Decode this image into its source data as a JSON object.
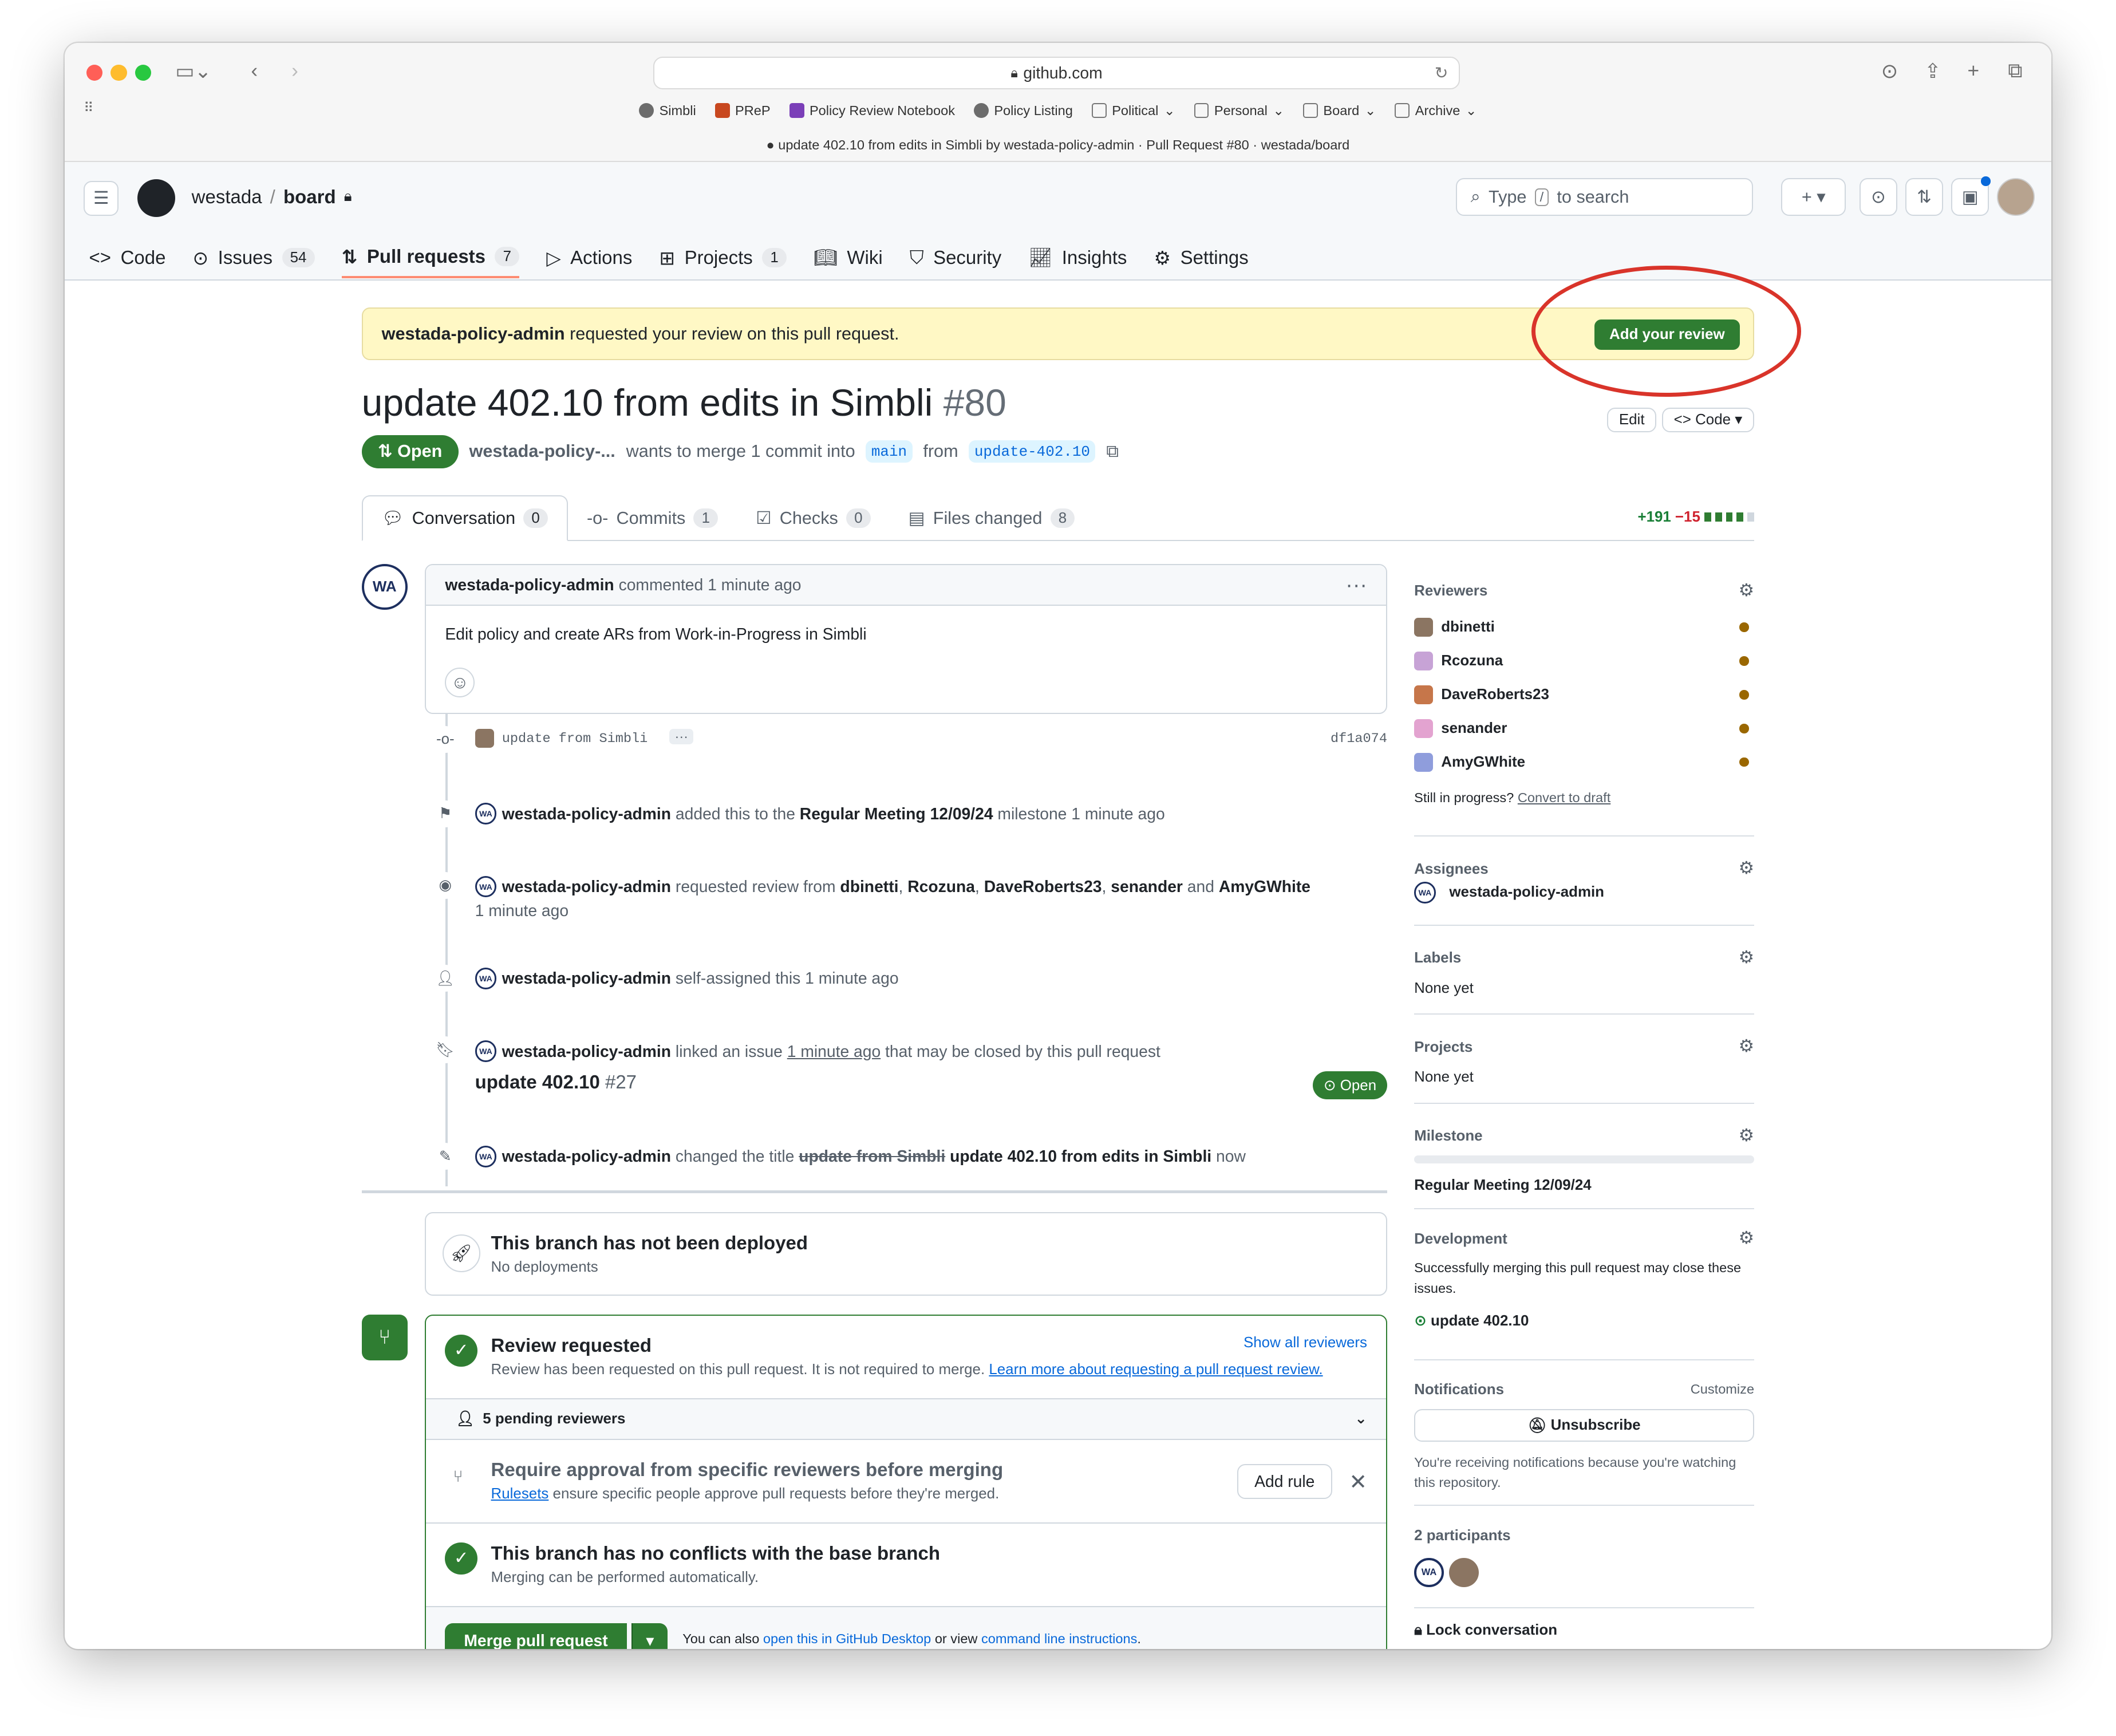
{
  "browser": {
    "url": "github.com",
    "bookmarks": [
      "Simbli",
      "PReP",
      "Policy Review Notebook",
      "Policy Listing",
      "Political",
      "Personal",
      "Board",
      "Archive"
    ],
    "tab_title": "update 402.10 from edits in Simbli by westada-policy-admin · Pull Request #80 · westada/board"
  },
  "repo": {
    "owner": "westada",
    "name": "board"
  },
  "search": {
    "placeholder_pre": "Type",
    "key": "/",
    "placeholder_post": "to search"
  },
  "nav": [
    {
      "label": "Code"
    },
    {
      "label": "Issues",
      "count": "54"
    },
    {
      "label": "Pull requests",
      "count": "7"
    },
    {
      "label": "Actions"
    },
    {
      "label": "Projects",
      "count": "1"
    },
    {
      "label": "Wiki"
    },
    {
      "label": "Security"
    },
    {
      "label": "Insights"
    },
    {
      "label": "Settings"
    }
  ],
  "banner": {
    "user": "westada-policy-admin",
    "text": "requested your review on this pull request.",
    "button": "Add your review"
  },
  "pr": {
    "title": "update 402.10 from edits in Simbli",
    "number": "#80",
    "edit": "Edit",
    "code": "Code",
    "status": "Open",
    "author": "westada-policy-...",
    "merge_text": "wants to merge 1 commit into",
    "base": "main",
    "from": "from",
    "head": "update-402.10"
  },
  "tabs": [
    {
      "label": "Conversation",
      "count": "0"
    },
    {
      "label": "Commits",
      "count": "1"
    },
    {
      "label": "Checks",
      "count": "0"
    },
    {
      "label": "Files changed",
      "count": "8"
    }
  ],
  "diffstat": {
    "add": "+191",
    "del": "−15"
  },
  "comment": {
    "author": "westada-policy-admin",
    "action": "commented 1 minute ago",
    "body": "Edit policy and create ARs from Work-in-Progress in Simbli"
  },
  "commit": {
    "message": "update from Simbli",
    "sha": "df1a074"
  },
  "events": {
    "milestone": {
      "user": "westada-policy-admin",
      "pre": "added this to the",
      "milestone": "Regular Meeting 12/09/24",
      "post": "milestone 1 minute ago"
    },
    "review": {
      "user": "westada-policy-admin",
      "pre": "requested review from",
      "r1": "dbinetti",
      "r2": "Rcozuna",
      "r3": "DaveRoberts23",
      "r4": "senander",
      "and": "and",
      "r5": "AmyGWhite",
      "time": "1 minute ago"
    },
    "assign": {
      "user": "westada-policy-admin",
      "text": "self-assigned this 1 minute ago"
    },
    "link": {
      "user": "westada-policy-admin",
      "pre": "linked an issue",
      "time": "1 minute ago",
      "post": "that may be closed by this pull request",
      "issue": "update 402.10",
      "issue_num": "#27",
      "status": "Open"
    },
    "rename": {
      "user": "westada-policy-admin",
      "pre": "changed the title",
      "old": "update from Simbli",
      "new": "update 402.10 from edits in Simbli",
      "time": "now"
    }
  },
  "deploy": {
    "title": "This branch has not been deployed",
    "sub": "No deployments"
  },
  "merge": {
    "review_title": "Review requested",
    "show_all": "Show all reviewers",
    "review_sub": "Review has been requested on this pull request. It is not required to merge.",
    "review_link": "Learn more about requesting a pull request review.",
    "pending": "5 pending reviewers",
    "rule_title": "Require approval from specific reviewers before merging",
    "rule_link": "Rulesets",
    "rule_sub": "ensure specific people approve pull requests before they're merged.",
    "add_rule": "Add rule",
    "conflict_title": "This branch has no conflicts with the base branch",
    "conflict_sub": "Merging can be performed automatically.",
    "merge_btn": "Merge pull request",
    "also": "You can also",
    "desktop": "open this in GitHub Desktop",
    "or": "or view",
    "cli": "command line instructions",
    "dot": "."
  },
  "sidebar": {
    "reviewers_h": "Reviewers",
    "reviewers": [
      "dbinetti",
      "Rcozuna",
      "DaveRoberts23",
      "senander",
      "AmyGWhite"
    ],
    "draft_q": "Still in progress?",
    "draft_link": "Convert to draft",
    "assignees_h": "Assignees",
    "assignee": "westada-policy-admin",
    "labels_h": "Labels",
    "labels": "None yet",
    "projects_h": "Projects",
    "projects": "None yet",
    "milestone_h": "Milestone",
    "milestone": "Regular Meeting 12/09/24",
    "dev_h": "Development",
    "dev_text": "Successfully merging this pull request may close these issues.",
    "dev_issue": "update 402.10",
    "notif_h": "Notifications",
    "customize": "Customize",
    "unsubscribe": "Unsubscribe",
    "notif_text": "You're receiving notifications because you're watching this repository.",
    "participants": "2 participants",
    "lock": "Lock conversation"
  },
  "colors": {
    "accent": "#2f7d32",
    "link": "#0969da",
    "annotation": "#d9342a"
  }
}
